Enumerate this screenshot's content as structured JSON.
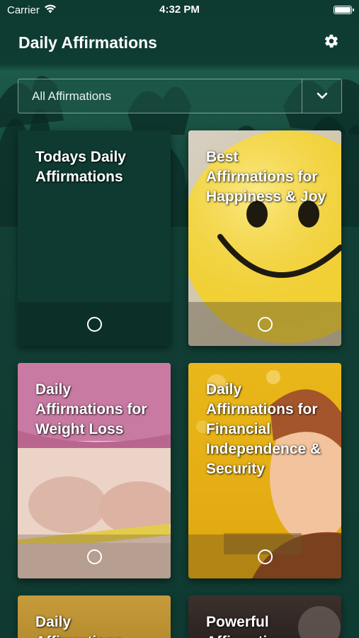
{
  "status_bar": {
    "carrier": "Carrier",
    "time": "4:32 PM",
    "wifi_icon": "wifi-icon",
    "battery_icon": "battery-icon"
  },
  "nav": {
    "title": "Daily Affirmations",
    "settings_icon": "gear-icon"
  },
  "filter": {
    "selected": "All Affirmations",
    "toggle_icon": "chevron-down-icon"
  },
  "cards": [
    {
      "title": "Todays Daily Affirmations",
      "status_icon": "circle-icon"
    },
    {
      "title": "Best Affirmations for Happiness & Joy",
      "status_icon": "circle-icon"
    },
    {
      "title": "Daily Affirmations for Weight Loss",
      "status_icon": "circle-icon"
    },
    {
      "title": "Daily Affirmations for Financial Independence & Security",
      "status_icon": "circle-icon"
    },
    {
      "title": "Daily Affirmations",
      "status_icon": "circle-icon"
    },
    {
      "title": "Powerful Affirmations",
      "status_icon": "circle-icon"
    }
  ],
  "colors": {
    "background": "#0f3b32",
    "card_dark": "#0e3a30",
    "text": "#ffffff"
  }
}
